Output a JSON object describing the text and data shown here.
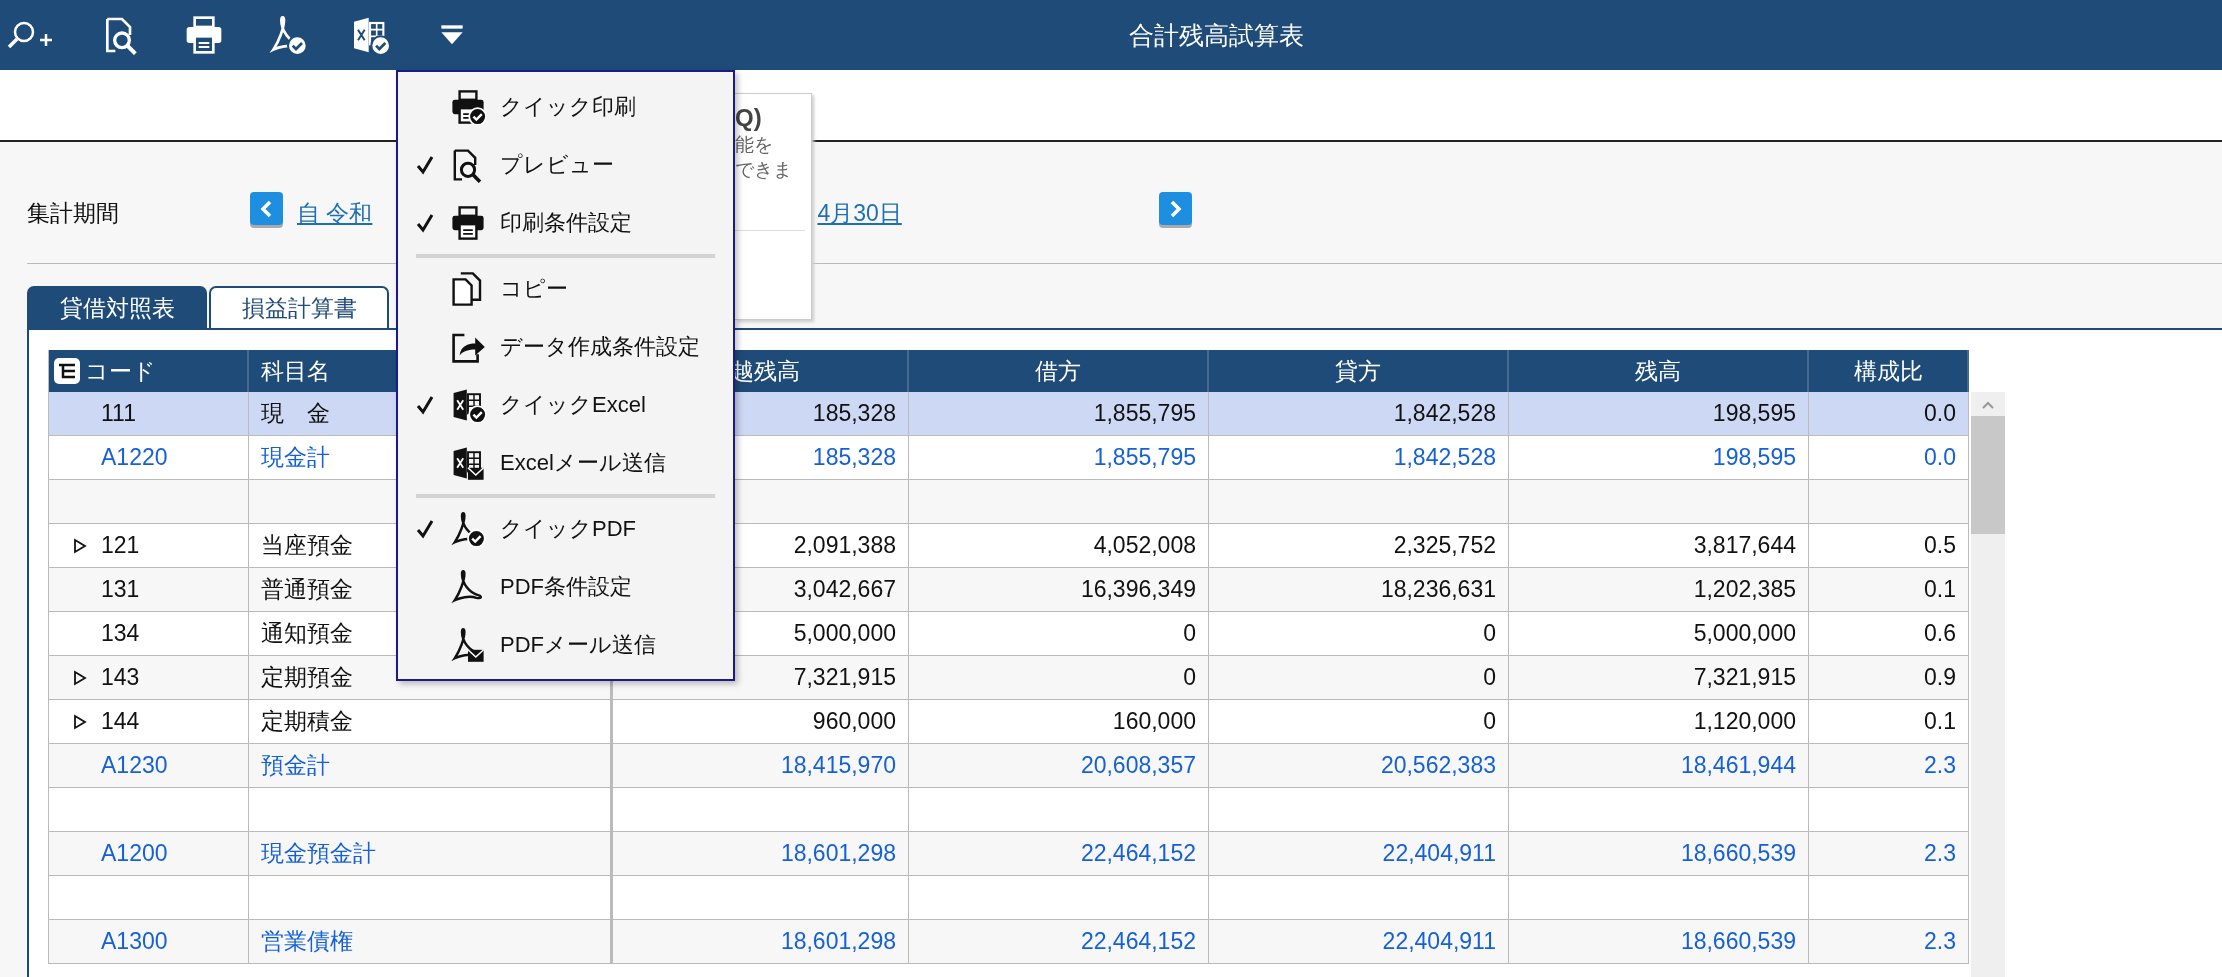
{
  "toolbar": {
    "title": "合計残高試算表"
  },
  "period": {
    "label": "集計期間",
    "from_text": "自 令和",
    "to_text": "4月30日"
  },
  "tooltip": {
    "heading": "Q)",
    "lines": [
      "能を",
      "できま"
    ]
  },
  "tabs": [
    {
      "label": "貸借対照表",
      "selected": true
    },
    {
      "label": "損益計算書",
      "selected": false
    }
  ],
  "table": {
    "columns": [
      "コード",
      "科目名",
      "越残高",
      "借方",
      "貸方",
      "残高",
      "構成比"
    ],
    "rows": [
      {
        "kind": "account",
        "code": "111",
        "name": "現　金",
        "cells": [
          "185,328",
          "1,855,795",
          "1,842,528",
          "198,595",
          "0.0"
        ],
        "expandable": false,
        "selected": true
      },
      {
        "kind": "total",
        "code": "A1220",
        "name": "現金計",
        "cells": [
          "185,328",
          "1,855,795",
          "1,842,528",
          "198,595",
          "0.0"
        ],
        "expandable": false,
        "selected": false
      },
      {
        "kind": "blank",
        "selected": false
      },
      {
        "kind": "account",
        "code": "121",
        "name": "当座預金",
        "cells": [
          "2,091,388",
          "4,052,008",
          "2,325,752",
          "3,817,644",
          "0.5"
        ],
        "expandable": true,
        "selected": false
      },
      {
        "kind": "account",
        "code": "131",
        "name": "普通預金",
        "cells": [
          "3,042,667",
          "16,396,349",
          "18,236,631",
          "1,202,385",
          "0.1"
        ],
        "expandable": false,
        "selected": false
      },
      {
        "kind": "account",
        "code": "134",
        "name": "通知預金",
        "cells": [
          "5,000,000",
          "0",
          "0",
          "5,000,000",
          "0.6"
        ],
        "expandable": false,
        "selected": false
      },
      {
        "kind": "account",
        "code": "143",
        "name": "定期預金",
        "cells": [
          "7,321,915",
          "0",
          "0",
          "7,321,915",
          "0.9"
        ],
        "expandable": true,
        "selected": false
      },
      {
        "kind": "account",
        "code": "144",
        "name": "定期積金",
        "cells": [
          "960,000",
          "160,000",
          "0",
          "1,120,000",
          "0.1"
        ],
        "expandable": true,
        "selected": false
      },
      {
        "kind": "total",
        "code": "A1230",
        "name": "預金計",
        "cells": [
          "18,415,970",
          "20,608,357",
          "20,562,383",
          "18,461,944",
          "2.3"
        ],
        "expandable": false,
        "selected": false
      },
      {
        "kind": "blank",
        "selected": false
      },
      {
        "kind": "total",
        "code": "A1200",
        "name": "現金預金計",
        "cells": [
          "18,601,298",
          "22,464,152",
          "22,404,911",
          "18,660,539",
          "2.3"
        ],
        "expandable": false,
        "selected": false
      },
      {
        "kind": "blank",
        "selected": false
      },
      {
        "kind": "total",
        "code": "A1300",
        "name": "営業債権",
        "cells": [
          "18,601,298",
          "22,464,152",
          "22,404,911",
          "18,660,539",
          "2.3"
        ],
        "expandable": false,
        "selected": false
      }
    ]
  },
  "menu": {
    "groups": [
      [
        {
          "label": "クイック印刷",
          "checked": false
        },
        {
          "label": "プレビュー",
          "checked": true
        },
        {
          "label": "印刷条件設定",
          "checked": true
        }
      ],
      [
        {
          "label": "コピー",
          "checked": false
        },
        {
          "label": "データ作成条件設定",
          "checked": false
        },
        {
          "label": "クイックExcel",
          "checked": true
        },
        {
          "label": "Excelメール送信",
          "checked": false
        }
      ],
      [
        {
          "label": "クイックPDF",
          "checked": true
        },
        {
          "label": "PDF条件設定",
          "checked": false
        },
        {
          "label": "PDFメール送信",
          "checked": false
        }
      ]
    ]
  }
}
